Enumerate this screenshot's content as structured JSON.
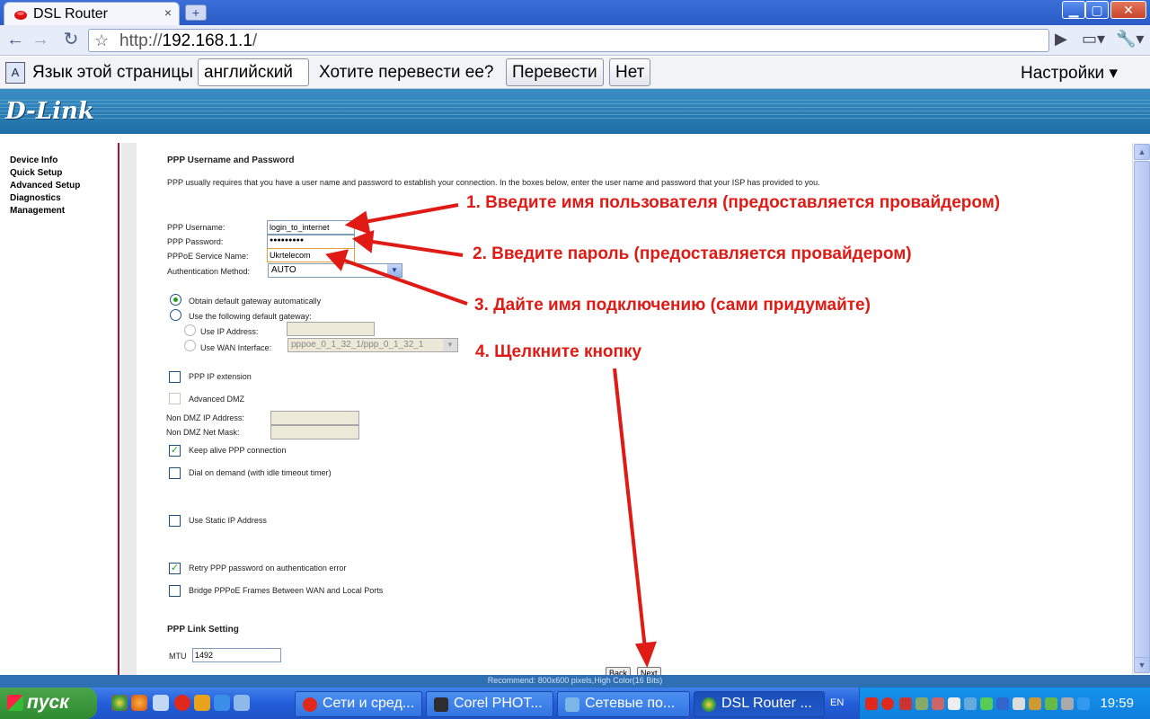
{
  "browser": {
    "tab_title": "DSL Router",
    "tab_close": "×",
    "new_tab": "+",
    "url_prefix": "http://",
    "url_host": "192.168.1.1",
    "url_suffix": "/"
  },
  "translate_bar": {
    "label": "Язык этой страницы",
    "language": "английский",
    "question": "Хотите перевести ее?",
    "translate_button": "Перевести",
    "no_button": "Нет",
    "settings": "Настройки"
  },
  "banner": {
    "logo": "D-Link"
  },
  "sidebar": {
    "items": [
      {
        "label": "Device Info"
      },
      {
        "label": "Quick Setup"
      },
      {
        "label": "Advanced Setup"
      },
      {
        "label": "Diagnostics"
      },
      {
        "label": "Management"
      }
    ]
  },
  "form": {
    "title": "PPP Username and Password",
    "description": "PPP usually requires that you have a user name and password to establish your connection. In the boxes below, enter the user name and password that your ISP has provided to you.",
    "username_label": "PPP Username:",
    "username_value": "login_to_internet",
    "password_label": "PPP Password:",
    "password_value": "●●●●●●●●●",
    "service_label": "PPPoE Service Name:",
    "service_value": "Ukrtelecom",
    "auth_label": "Authentication Method:",
    "auth_value": "AUTO",
    "gw_auto": "Obtain default gateway automatically",
    "gw_manual": "Use the following default gateway:",
    "use_ip": "Use IP Address:",
    "use_wan": "Use WAN Interface:",
    "wan_value": "pppoe_0_1_32_1/ppp_0_1_32_1",
    "ppp_ip_ext": "PPP IP extension",
    "adv_dmz": "Advanced DMZ",
    "non_dmz_ip": "Non DMZ IP Address:",
    "non_dmz_mask": "Non DMZ Net Mask:",
    "keep_alive": "Keep alive PPP connection",
    "dial_demand": "Dial on demand (with idle timeout timer)",
    "static_ip": "Use Static IP Address",
    "retry_pw": "Retry PPP password on authentication error",
    "bridge": "Bridge PPPoE Frames Between WAN and Local Ports",
    "link_title": "PPP Link Setting",
    "mtu_label": "MTU",
    "mtu_value": "1492",
    "back": "Back",
    "next": "Next"
  },
  "annotations": {
    "a1": "1. Введите имя пользователя (предоставляется провайдером)",
    "a2": "2. Введите пароль (предоставляется провайдером)",
    "a3": "3. Дайте имя подключению (сами придумайте)",
    "a4": "4. Щелкните кнопку"
  },
  "status_bar": "Recommend: 800x600 pixels,High Color(16 Bits)",
  "taskbar": {
    "start": "пуск",
    "tasks": [
      {
        "label": "Сети и сред..."
      },
      {
        "label": "Corel PHOT..."
      },
      {
        "label": "Сетевые по..."
      },
      {
        "label": "DSL Router ..."
      }
    ],
    "lang": "EN",
    "clock": "19:59"
  },
  "colors": {
    "annotation": "#e01a14",
    "dlink_blue": "#1f6ea7",
    "nav_border": "#b01030"
  }
}
